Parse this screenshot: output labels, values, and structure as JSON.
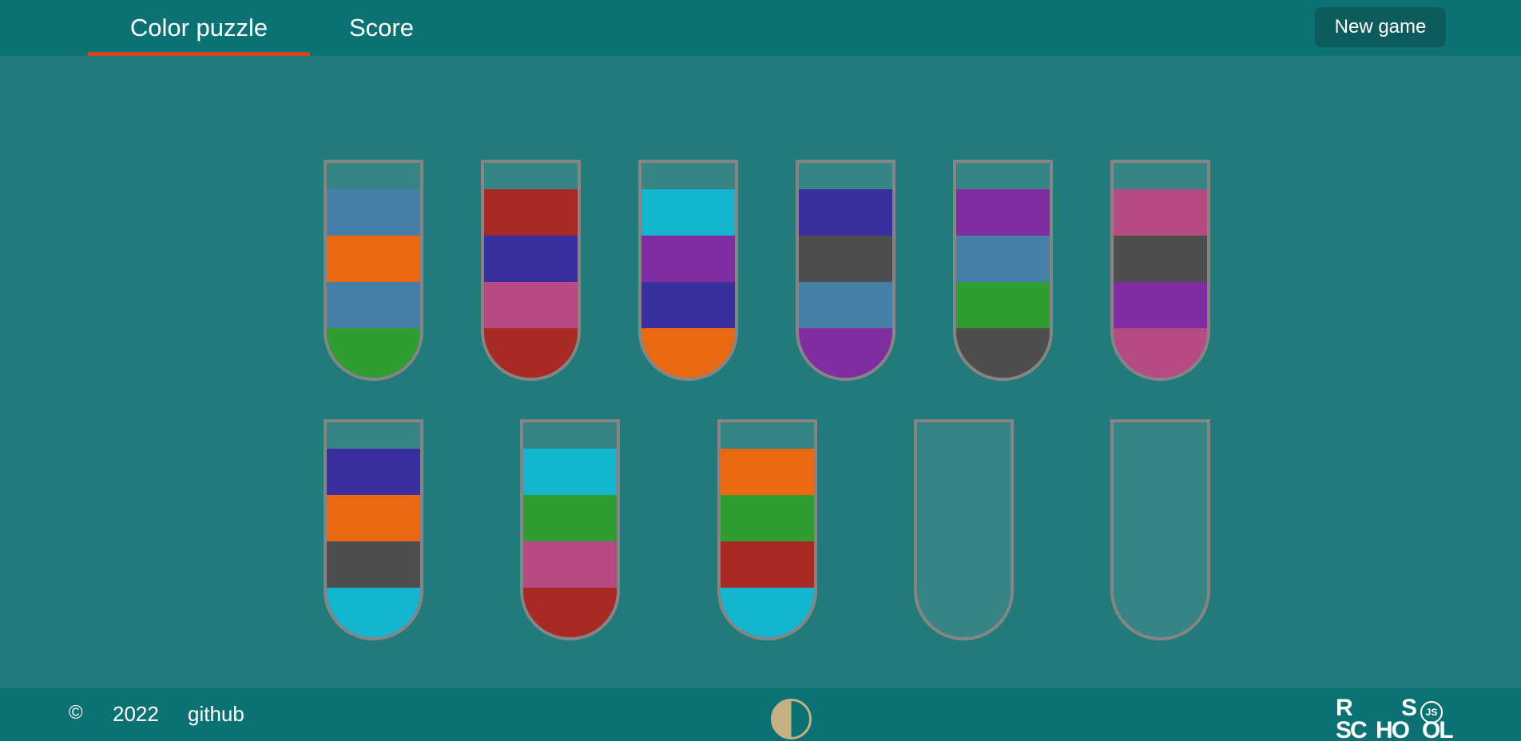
{
  "header": {
    "tabs": [
      {
        "label": "Color puzzle",
        "active": true
      },
      {
        "label": "Score",
        "active": false
      }
    ],
    "new_game_label": "New game"
  },
  "colors": {
    "steelblue": "#4680a8",
    "orange": "#ea6812",
    "green": "#2f9d32",
    "red": "#a72a24",
    "indigo": "#3a2f9e",
    "pink": "#b64b84",
    "cyan": "#14b5ce",
    "purple": "#7f2da0",
    "gray": "#4e4e4e",
    "accent": "#d1481f",
    "header_bg": "#0b7173",
    "board_bg": "#237a7a",
    "tube_empty": "#378484",
    "tube_border": "#858585"
  },
  "tubes": [
    {
      "layers": [
        "steelblue",
        "orange",
        "steelblue",
        "green"
      ]
    },
    {
      "layers": [
        "red",
        "indigo",
        "pink",
        "red"
      ]
    },
    {
      "layers": [
        "cyan",
        "purple",
        "indigo",
        "orange"
      ]
    },
    {
      "layers": [
        "indigo",
        "gray",
        "steelblue",
        "purple"
      ]
    },
    {
      "layers": [
        "purple",
        "steelblue",
        "green",
        "gray"
      ]
    },
    {
      "layers": [
        "pink",
        "gray",
        "purple",
        "pink"
      ]
    },
    {
      "layers": [
        "indigo",
        "orange",
        "gray",
        "cyan"
      ]
    },
    {
      "layers": [
        "cyan",
        "green",
        "pink",
        "red"
      ]
    },
    {
      "layers": [
        "orange",
        "green",
        "red",
        "cyan"
      ]
    },
    {
      "layers": []
    },
    {
      "layers": []
    }
  ],
  "footer": {
    "copyright": "©",
    "year": "2022",
    "github_label": "github",
    "theme_icon": "half-circle-icon",
    "logo": {
      "r": "R",
      "s": "S",
      "sc": "SC",
      "ho": "HO",
      "ol": "OL",
      "js": "JS"
    }
  }
}
